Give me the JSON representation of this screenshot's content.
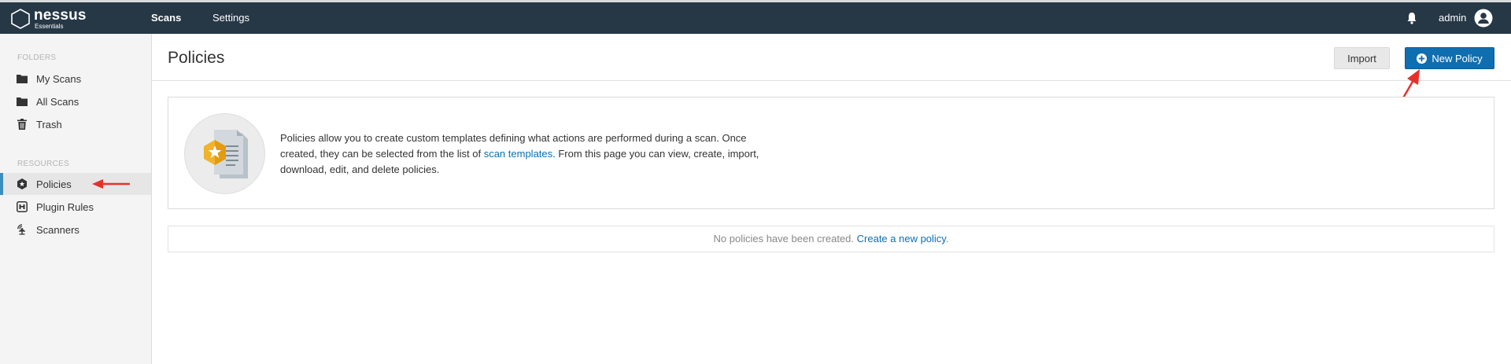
{
  "app": {
    "logo_name": "nessus",
    "logo_sub": "Essentials"
  },
  "nav": {
    "items": [
      {
        "label": "Scans"
      },
      {
        "label": "Settings"
      }
    ]
  },
  "user": {
    "name": "admin"
  },
  "sidebar": {
    "folders_heading": "FOLDERS",
    "folders": [
      {
        "label": "My Scans",
        "icon": "folder-icon"
      },
      {
        "label": "All Scans",
        "icon": "folder-icon"
      },
      {
        "label": "Trash",
        "icon": "trash-icon"
      }
    ],
    "resources_heading": "RESOURCES",
    "resources": [
      {
        "label": "Policies",
        "icon": "shield-icon"
      },
      {
        "label": "Plugin Rules",
        "icon": "plugin-rules-icon"
      },
      {
        "label": "Scanners",
        "icon": "scanner-icon"
      }
    ]
  },
  "main": {
    "title": "Policies",
    "import_label": "Import",
    "new_policy_label": "New Policy",
    "info": {
      "text_before": "Policies allow you to create custom templates defining what actions are performed during a scan. Once created, they can be selected from the list of ",
      "link": "scan templates",
      "text_after": ". From this page you can view, create, import, download, edit, and delete policies."
    },
    "empty": {
      "text": "No policies have been created.",
      "link": "Create a new policy"
    }
  },
  "colors": {
    "topbar": "#263746",
    "accent": "#0f6eb0",
    "annotation_arrow": "#e8302b"
  }
}
